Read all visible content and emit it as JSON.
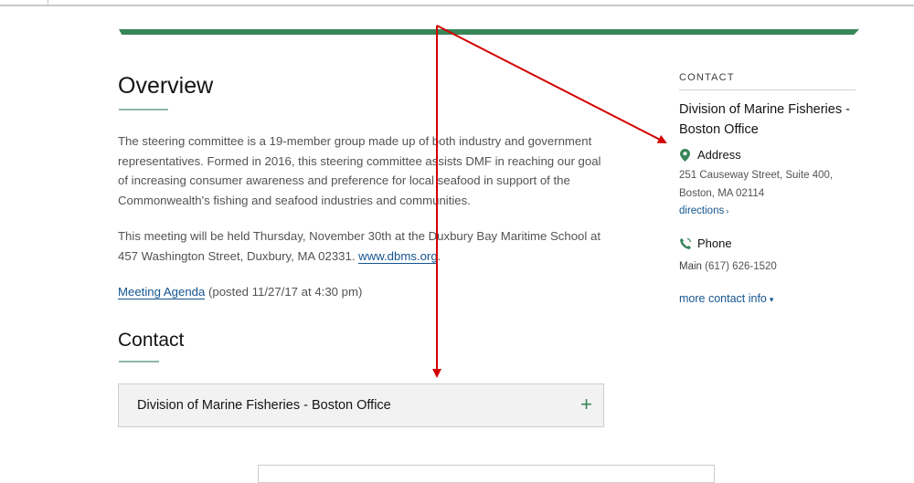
{
  "overview": {
    "title": "Overview",
    "paragraph1": "The steering committee is a 19-member group made up of both industry and government representatives. Formed in 2016, this steering committee assists DMF in reaching our goal of increasing consumer awareness and preference for local seafood in support of the Commonwealth's fishing and seafood industries and communities.",
    "paragraph2_text": "This meeting will be held Thursday, November 30th at the Duxbury Bay Maritime School at 457 Washington Street, Duxbury, MA 02331.",
    "paragraph2_link": "www.dbms.org",
    "paragraph2_end": ".",
    "agenda_link": "Meeting Agenda",
    "agenda_posted": "(posted 11/27/17 at 4:30 pm)"
  },
  "contact_section": {
    "title": "Contact",
    "accordion_label": "Division of Marine Fisheries - Boston Office",
    "accordion_icon": "+"
  },
  "sidebar": {
    "heading": "CONTACT",
    "org_name": "Division of Marine Fisheries - Boston Office",
    "address_label": "Address",
    "address_line1": "251 Causeway Street, Suite 400,",
    "address_line2": "Boston, MA 02114",
    "directions": "directions",
    "directions_arrow": "›",
    "phone_label": "Phone",
    "phone_type": "Main",
    "phone_number": "(617) 626-1520",
    "more_contact": "more contact info",
    "more_contact_chevron": "▾"
  },
  "colors": {
    "accent_green": "#388557",
    "link_blue": "#14558f",
    "annotation_red": "#d40000"
  }
}
